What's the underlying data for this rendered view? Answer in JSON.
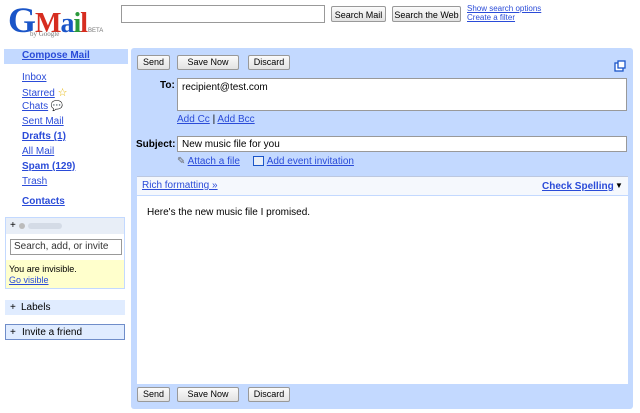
{
  "header": {
    "logo_text": "Gmail",
    "logo_by": "by Google",
    "logo_beta": "BETA",
    "search_value": "",
    "search_mail_label": "Search Mail",
    "search_web_label": "Search the Web",
    "show_options": "Show search options",
    "create_filter": "Create a filter"
  },
  "sidebar": {
    "compose": "Compose Mail",
    "items": {
      "inbox": "Inbox",
      "starred": "Starred",
      "chats": "Chats",
      "sent": "Sent Mail",
      "drafts": "Drafts (1)",
      "all": "All Mail",
      "spam": "Spam (129)",
      "trash": "Trash"
    },
    "contacts": "Contacts",
    "chat": {
      "search_placeholder": "Search, add, or invite",
      "invisible": "You are invisible.",
      "go_visible": "Go visible"
    },
    "labels": "Labels",
    "invite": "Invite a friend"
  },
  "compose": {
    "send": "Send",
    "save_now": "Save Now",
    "discard": "Discard",
    "to_label": "To:",
    "to_value": "recipient@test.com",
    "add_cc": "Add Cc",
    "cc_sep": "|",
    "add_bcc": "Add Bcc",
    "subject_label": "Subject:",
    "subject_value": "New music file for you",
    "attach": "Attach a file",
    "add_event": "Add event invitation",
    "rich_formatting": "Rich formatting »",
    "check_spelling": "Check Spelling",
    "check_arrow": "▼",
    "body": "Here's the new music file I promised."
  },
  "colors": {
    "accent": "#c3d9ff",
    "link": "#2a4bd8",
    "invisible_bg": "#ffffcc"
  }
}
